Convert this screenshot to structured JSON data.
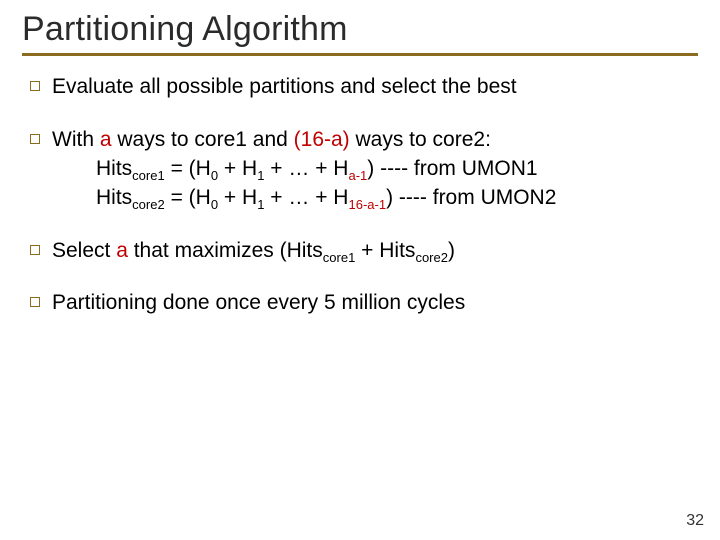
{
  "title": "Partitioning Algorithm",
  "bullets": {
    "b1": "Evaluate all possible partitions and select the best",
    "b2_pre": "With ",
    "b2_a": "a",
    "b2_mid1": " ways to core1 and ",
    "b2_paren": "(16-a)",
    "b2_post": " ways to core2:",
    "b2_line1_lhs": "Hits",
    "b2_line1_sub": "core1",
    "b2_line1_eq": " = (H",
    "b2_line1_s0": "0",
    "b2_line1_p1": " + H",
    "b2_line1_s1": "1",
    "b2_line1_p2": " + … + H",
    "b2_line1_s2": "a-1",
    "b2_line1_end": ")    ---- from UMON1",
    "b2_line2_lhs": "Hits",
    "b2_line2_sub": "core2",
    "b2_line2_eq": " = (H",
    "b2_line2_s0": "0",
    "b2_line2_p1": " + H",
    "b2_line2_s1": "1",
    "b2_line2_p2": " + … + H",
    "b2_line2_s2": "16-a-1",
    "b2_line2_end": ") ---- from UMON2",
    "b3_pre": "Select ",
    "b3_a": "a",
    "b3_mid": " that maximizes (Hits",
    "b3_sub1": "core1",
    "b3_plus": " + Hits",
    "b3_sub2": "core2",
    "b3_end": ")",
    "b4": "Partitioning done once every 5 million cycles"
  },
  "pagenum": "32"
}
